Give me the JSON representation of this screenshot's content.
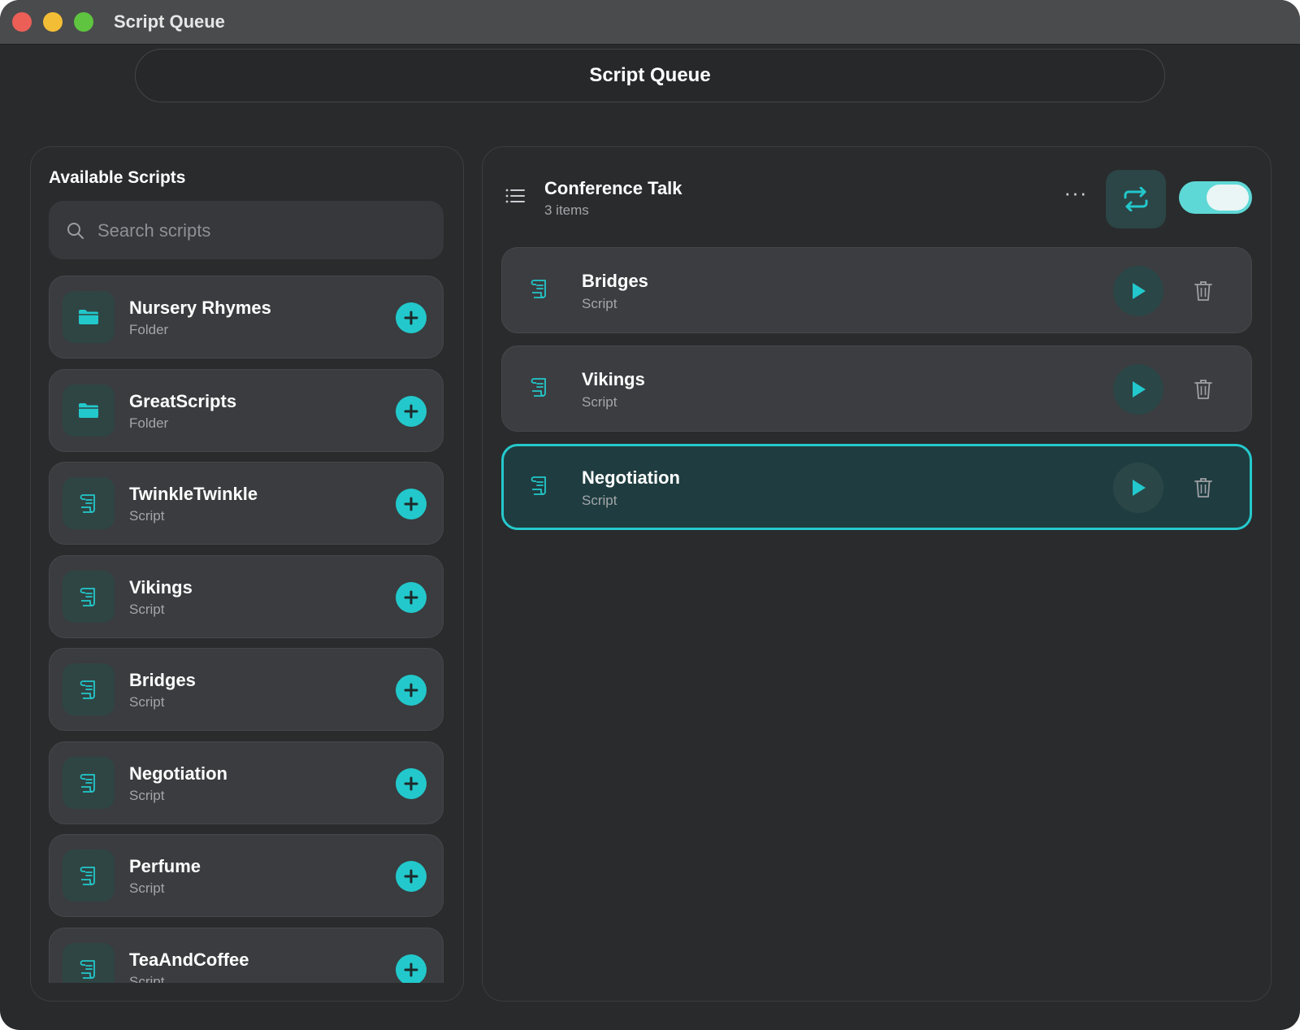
{
  "window": {
    "title": "Script Queue"
  },
  "header": {
    "title": "Script Queue"
  },
  "available": {
    "title": "Available Scripts",
    "search_placeholder": "Search scripts",
    "items": [
      {
        "name": "Nursery Rhymes",
        "type": "Folder",
        "icon": "folder-icon"
      },
      {
        "name": "GreatScripts",
        "type": "Folder",
        "icon": "folder-icon"
      },
      {
        "name": "TwinkleTwinkle",
        "type": "Script",
        "icon": "script-icon"
      },
      {
        "name": "Vikings",
        "type": "Script",
        "icon": "script-icon"
      },
      {
        "name": "Bridges",
        "type": "Script",
        "icon": "script-icon"
      },
      {
        "name": "Negotiation",
        "type": "Script",
        "icon": "script-icon"
      },
      {
        "name": "Perfume",
        "type": "Script",
        "icon": "script-icon"
      },
      {
        "name": "TeaAndCoffee",
        "type": "Script",
        "icon": "script-icon"
      }
    ]
  },
  "queue": {
    "title": "Conference Talk",
    "count": "3 items",
    "more_label": "···",
    "loop_enabled": true,
    "items": [
      {
        "name": "Bridges",
        "type": "Script",
        "selected": false
      },
      {
        "name": "Vikings",
        "type": "Script",
        "selected": false
      },
      {
        "name": "Negotiation",
        "type": "Script",
        "selected": true
      }
    ]
  },
  "colors": {
    "accent": "#22c8cb",
    "background": "#282a2c",
    "card": "#3a3c3f",
    "selected_card": "#1f3d40"
  }
}
